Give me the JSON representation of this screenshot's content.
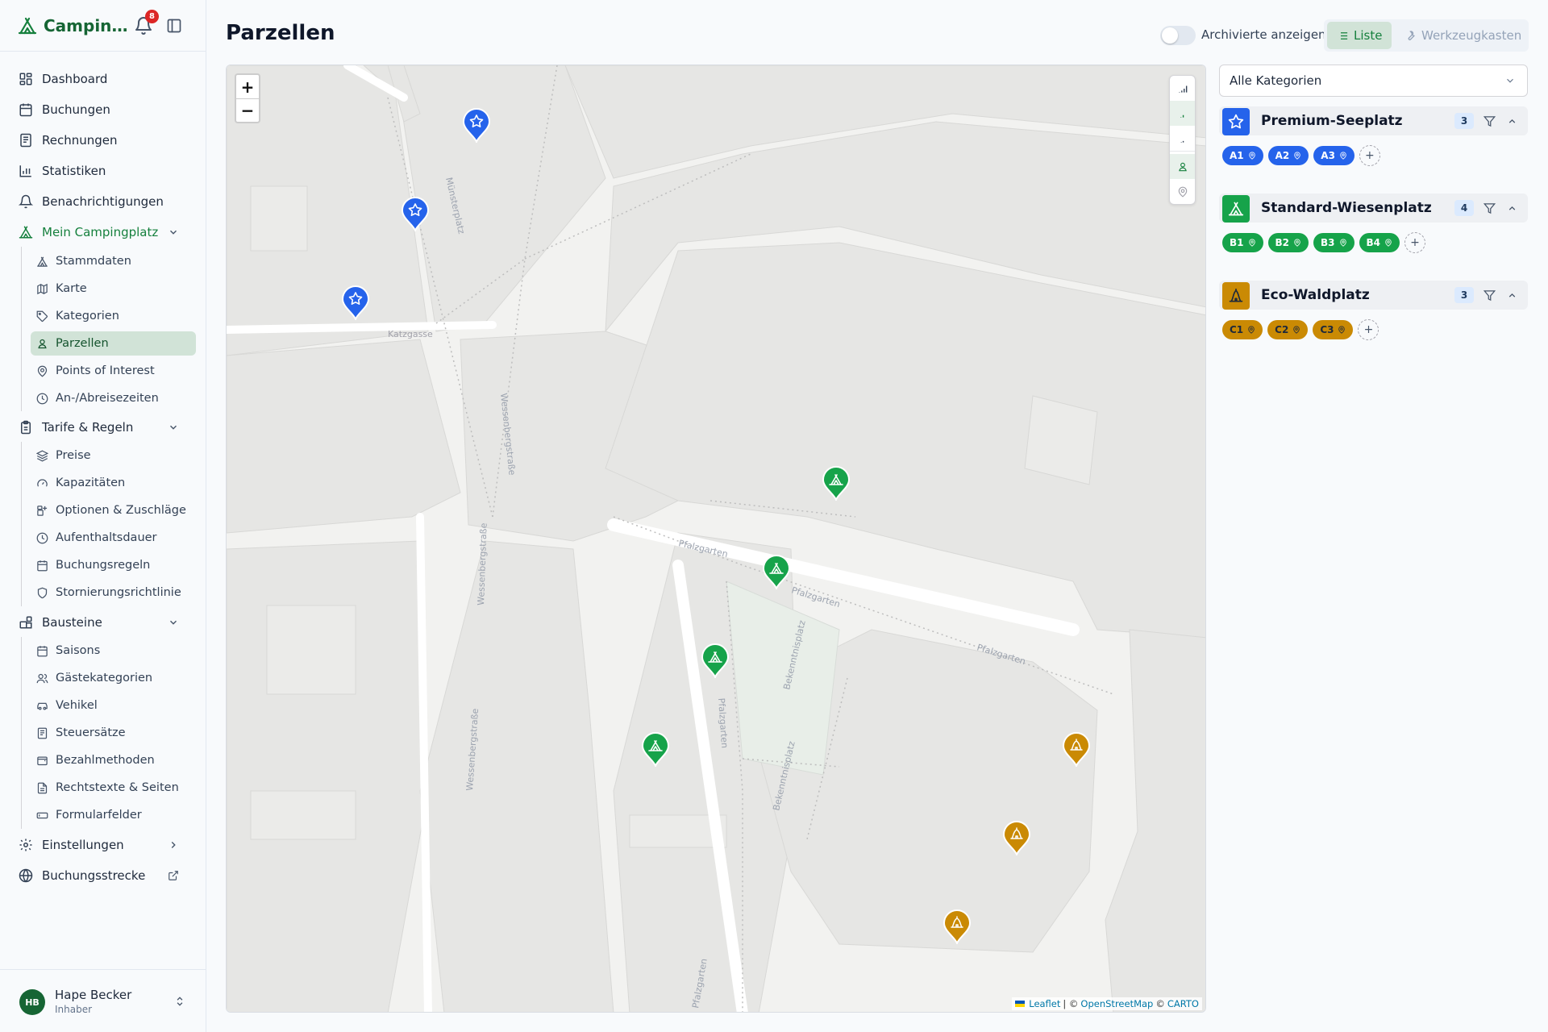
{
  "app": {
    "name": "Campingplatz",
    "notifications_count": "8"
  },
  "nav": {
    "dashboard": "Dashboard",
    "buchungen": "Buchungen",
    "rechnungen": "Rechnungen",
    "statistiken": "Statistiken",
    "benachrichtigungen": "Benachrichtigungen",
    "mein_campingplatz": "Mein Campingplatz",
    "mein_sub": [
      "Stammdaten",
      "Karte",
      "Kategorien",
      "Parzellen",
      "Points of Interest",
      "An-/Abreisezeiten"
    ],
    "tarife": "Tarife & Regeln",
    "tarife_sub": [
      "Preise",
      "Kapazitäten",
      "Optionen & Zuschläge",
      "Aufenthaltsdauer",
      "Buchungsregeln",
      "Stornierungsrichtlinie"
    ],
    "bausteine": "Bausteine",
    "bausteine_sub": [
      "Saisons",
      "Gästekategorien",
      "Vehikel",
      "Steuersätze",
      "Bezahlmethoden",
      "Rechtstexte & Seiten",
      "Formularfelder"
    ],
    "einstellungen": "Einstellungen",
    "buchungsstrecke": "Buchungsstrecke"
  },
  "user": {
    "initials": "HB",
    "name": "Hape Becker",
    "role": "Inhaber"
  },
  "header": {
    "title": "Parzellen",
    "archived_toggle_label": "Archivierte anzeigen",
    "archived_toggle_on": false,
    "view_list": "Liste",
    "view_tools": "Werkzeugkasten"
  },
  "map": {
    "zoom_in": "+",
    "zoom_out": "−",
    "streets": [
      "Münsterplatz",
      "Katzgasse",
      "Wessenbergstraße",
      "Wessenbergstraße",
      "Wessenbergstraße",
      "Pfalzgarten",
      "Pfalzgarten",
      "Pfalzgarten",
      "Pfalzgarten",
      "Bekenntnisplatz",
      "Bekenntnisplatz",
      "Pfalzgarten"
    ],
    "attribution": {
      "leaflet": "Leaflet",
      "sep1": "| ©",
      "osm": "OpenStreetMap",
      "sep2": "©",
      "carto": "CARTO"
    }
  },
  "panel": {
    "category_filter": "Alle Kategorien",
    "groups": [
      {
        "name": "Premium-Seeplatz",
        "count": "3",
        "color": "#2563eb",
        "icon": "star-icon",
        "plots": [
          "A1",
          "A2",
          "A3"
        ]
      },
      {
        "name": "Standard-Wiesenplatz",
        "count": "4",
        "color": "#16a34a",
        "icon": "tent-icon",
        "plots": [
          "B1",
          "B2",
          "B3",
          "B4"
        ]
      },
      {
        "name": "Eco-Waldplatz",
        "count": "3",
        "color": "#ca8a04",
        "icon": "bell-tent-icon",
        "plots": [
          "C1",
          "C2",
          "C3"
        ]
      }
    ],
    "add_label": "+"
  },
  "colors": {
    "accent": "#15803d",
    "premium": "#2563eb",
    "standard": "#16a34a",
    "eco": "#ca8a04"
  }
}
